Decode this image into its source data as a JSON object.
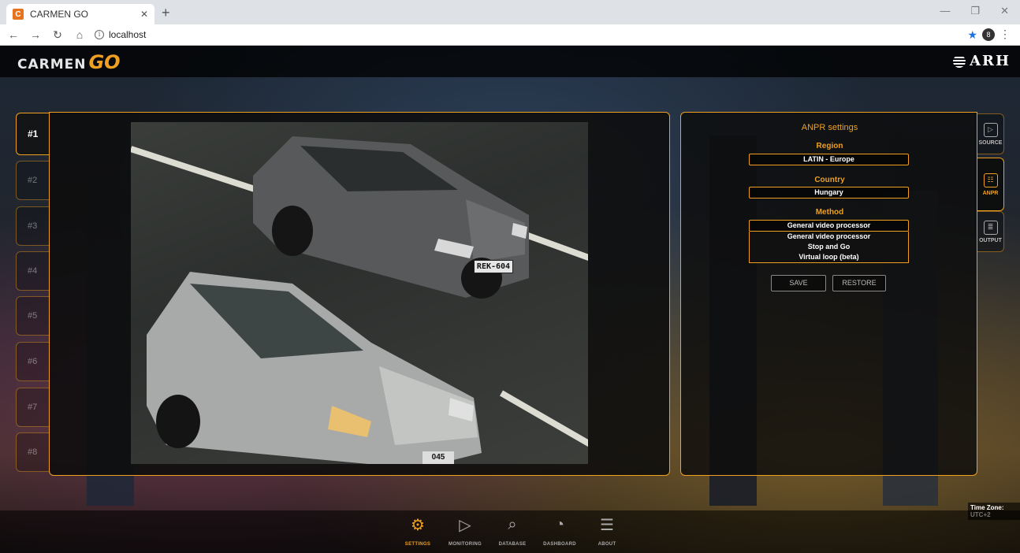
{
  "browser": {
    "tab_title": "CARMEN GO",
    "tab_favicon": "carmen-go-favicon",
    "url": "localhost",
    "profile_initial": "8"
  },
  "header": {
    "logo_text": "CARMEN",
    "logo_go": "GO",
    "brand_logo": "ARH"
  },
  "channels": [
    "#1",
    "#2",
    "#3",
    "#4",
    "#5",
    "#6",
    "#7",
    "#8"
  ],
  "active_channel": "#1",
  "camera": {
    "plate_1": "REK-604",
    "plate_2": "045"
  },
  "anpr": {
    "title": "ANPR settings",
    "region_label": "Region",
    "region_value": "LATIN - Europe",
    "country_label": "Country",
    "country_value": "Hungary",
    "method_label": "Method",
    "method_value": "General video processor",
    "method_options": [
      "General video processor",
      "Stop and Go",
      "Virtual loop (beta)"
    ],
    "save_label": "SAVE",
    "restore_label": "RESTORE"
  },
  "side_tabs": [
    {
      "label": "SOURCE",
      "icon": "source-icon"
    },
    {
      "label": "ANPR",
      "icon": "anpr-icon"
    },
    {
      "label": "OUTPUT",
      "icon": "output-icon"
    }
  ],
  "active_side_tab": "ANPR",
  "timezone": "Time Zone: UTC+2",
  "bottom_nav": [
    {
      "label": "SETTINGS",
      "icon": "gear-icon"
    },
    {
      "label": "MONITORING",
      "icon": "monitoring-icon"
    },
    {
      "label": "DATABASE",
      "icon": "database-icon"
    },
    {
      "label": "DASHBOARD",
      "icon": "dashboard-icon"
    },
    {
      "label": "ABOUT",
      "icon": "about-icon"
    }
  ],
  "active_nav": "SETTINGS",
  "colors": {
    "accent": "#f0a020",
    "panel_bg": "#0c0c0c",
    "chrome_tab": "#dee1e6"
  }
}
